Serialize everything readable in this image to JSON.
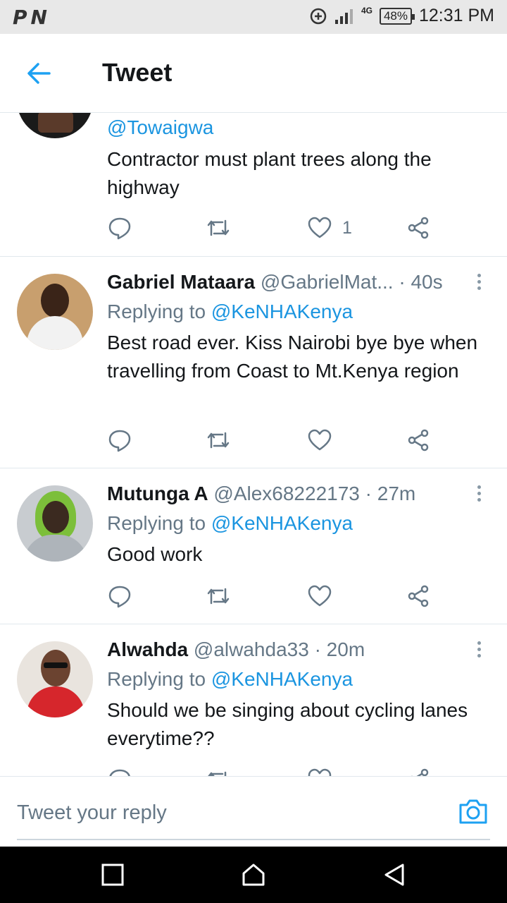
{
  "status_bar": {
    "left_icons": [
      "P",
      "N"
    ],
    "network": "4G",
    "battery": "48%",
    "time": "12:31 PM"
  },
  "header": {
    "title": "Tweet"
  },
  "partial_tweet": {
    "handle": "@Towaigwa",
    "text": "Contractor must plant trees along the highway",
    "likes": "1"
  },
  "tweets": [
    {
      "name": "Gabriel Mataara",
      "handle": "@GabrielMat...",
      "time": "· 40s",
      "replying_prefix": "Replying to ",
      "replying_to": "@KeNHAKenya",
      "text": "Best road ever. Kiss Nairobi bye bye when travelling from Coast to Mt.Kenya region"
    },
    {
      "name": "Mutunga A",
      "handle": "@Alex68222173",
      "time": "· 27m",
      "replying_prefix": "Replying to ",
      "replying_to": "@KeNHAKenya",
      "text": "Good work"
    },
    {
      "name": "Alwahda",
      "handle": "@alwahda33",
      "time": "· 20m",
      "replying_prefix": "Replying to ",
      "replying_to": "@KeNHAKenya",
      "text": "Should we be singing about cycling lanes everytime??"
    }
  ],
  "reply_bar": {
    "placeholder": "Tweet your reply"
  },
  "colors": {
    "accent": "#1da1f2",
    "secondary_text": "#657786",
    "divider": "#e1e8ed"
  },
  "icons": [
    "back-arrow-icon",
    "reply-icon",
    "retweet-icon",
    "like-icon",
    "share-icon",
    "more-icon",
    "camera-icon",
    "recents-icon",
    "home-icon",
    "back-icon"
  ]
}
